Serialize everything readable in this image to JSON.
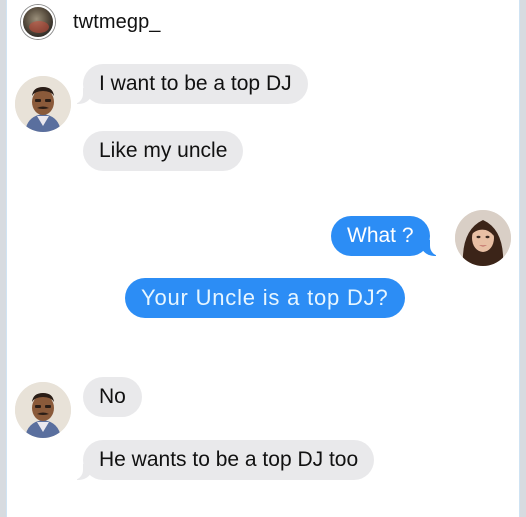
{
  "header": {
    "username": "twtmegp_",
    "avatar_icon": "profile-avatar-icon"
  },
  "conversation": {
    "messages": [
      {
        "sender": "uncle",
        "text": "I want to be a top DJ"
      },
      {
        "sender": "uncle",
        "text": "Like my uncle"
      },
      {
        "sender": "woman",
        "text": "What ?"
      },
      {
        "sender": "woman",
        "text": "Your Uncle is a top DJ?"
      },
      {
        "sender": "uncle",
        "text": "No"
      },
      {
        "sender": "uncle",
        "text": "He wants to be a top DJ too"
      }
    ]
  },
  "colors": {
    "received_bubble": "#e9e9eb",
    "sent_bubble": "#2c8df5",
    "background": "#ffffff"
  }
}
